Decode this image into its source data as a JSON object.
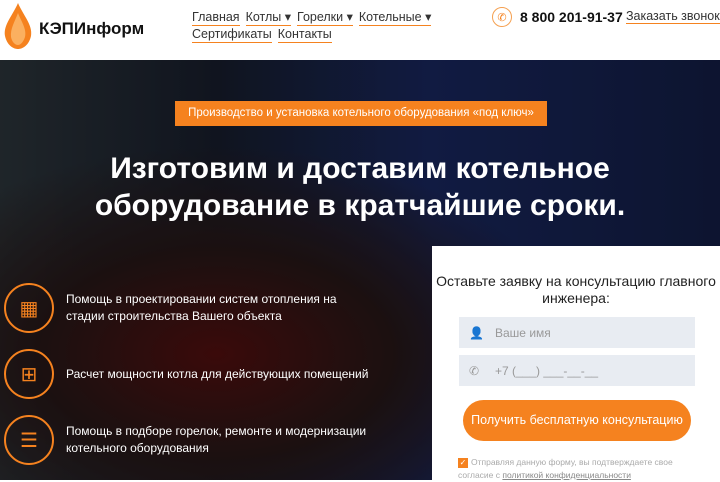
{
  "header": {
    "logo": "КЭПИнформ",
    "nav": [
      "Главная",
      "Котлы",
      "Горелки",
      "Котельные",
      "Сертификаты",
      "Контакты"
    ],
    "phone": "8 800 201-91-37",
    "callback": "Заказать звонок"
  },
  "hero": {
    "badge": "Производство и установка котельного оборудования «под ключ»",
    "title": "Изготовим и доставим котельное оборудование в кратчайшие сроки.",
    "features": [
      "Помощь в проектировании систем отопления на стадии строительства Вашего объекта",
      "Расчет мощности котла для действующих помещений",
      "Помощь в подборе горелок, ремонте и модернизации котельного оборудования"
    ]
  },
  "form": {
    "title": "Оставьте заявку на консультацию главного инженера:",
    "name_placeholder": "Ваше имя",
    "phone_placeholder": "+7 (___) ___-__-__",
    "submit": "Получить бесплатную консультацию",
    "agree_text": "Отправляя данную форму, вы подтверждаете свое согласие с",
    "agree_link": "политикой конфиденциальности"
  }
}
